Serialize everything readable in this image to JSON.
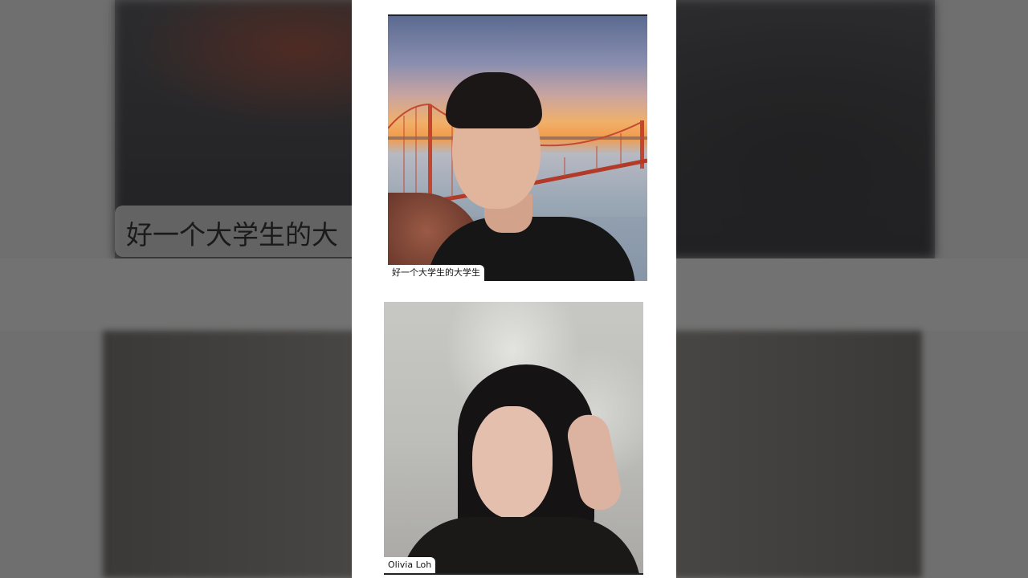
{
  "background": {
    "caption_text": "好一个大学生的大"
  },
  "participants": [
    {
      "name": "好一个大学生的大学生",
      "background": "golden-gate-bridge-sunset"
    },
    {
      "name": "Olivia Loh",
      "background": "office-blurred"
    }
  ],
  "colors": {
    "panel": "#ffffff",
    "pillarbox": "#6f6f6f",
    "name_tag_bg": "#ffffff",
    "name_tag_text": "#111111"
  }
}
